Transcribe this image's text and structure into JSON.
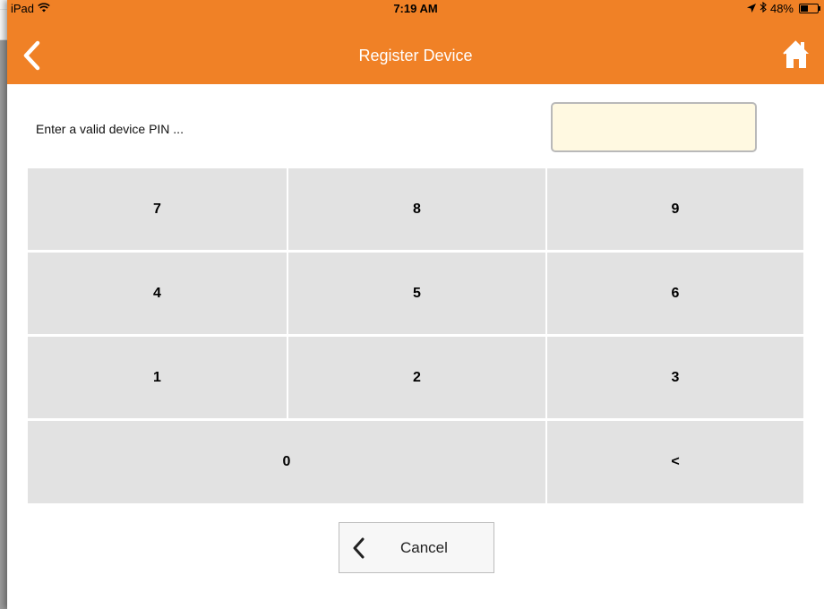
{
  "status_bar": {
    "device": "iPad",
    "time": "7:19 AM",
    "battery": "48%"
  },
  "nav": {
    "title": "Register Device",
    "back_icon": "chevron-left-icon",
    "home_icon": "home-icon"
  },
  "pin": {
    "prompt": "Enter a valid device PIN ...",
    "value": ""
  },
  "keypad": {
    "k7": "7",
    "k8": "8",
    "k9": "9",
    "k4": "4",
    "k5": "5",
    "k6": "6",
    "k1": "1",
    "k2": "2",
    "k3": "3",
    "k0": "0",
    "backspace": "<"
  },
  "cancel": {
    "label": "Cancel"
  },
  "colors": {
    "brand_orange": "#f08126",
    "key_gray": "#e2e2e2",
    "input_bg": "#fff9e1"
  }
}
